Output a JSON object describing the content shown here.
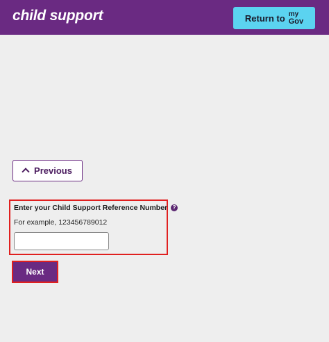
{
  "header": {
    "brand": "child support",
    "return_label": "Return to",
    "return_logo_top": "my",
    "return_logo_bottom": "Gov"
  },
  "nav": {
    "previous_label": "Previous"
  },
  "form": {
    "reference_label": "Enter your Child Support Reference Number",
    "help_glyph": "?",
    "example_text": "For example, 123456789012",
    "reference_value": "",
    "next_label": "Next"
  },
  "colors": {
    "header_bg": "#6a2a82",
    "return_button_bg": "#5bd3f0",
    "page_bg": "#eeeeee",
    "highlight_border": "#e0201f"
  }
}
